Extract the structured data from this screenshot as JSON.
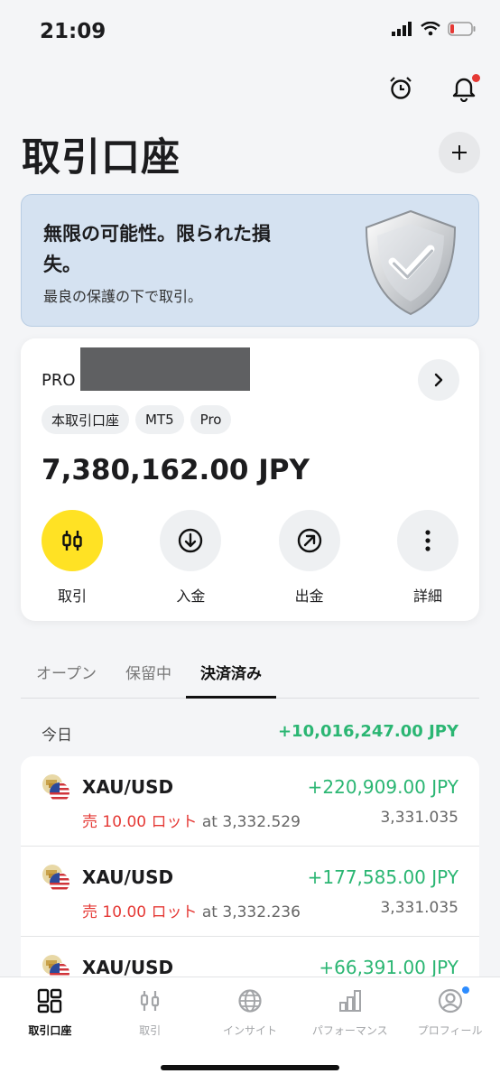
{
  "status_bar": {
    "time": "21:09"
  },
  "header": {
    "title": "取引口座"
  },
  "banner": {
    "title": "無限の可能性。限られた損失。",
    "subtitle": "最良の保護の下で取引。"
  },
  "account": {
    "name": "PRO",
    "tags": [
      "本取引口座",
      "MT5",
      "Pro"
    ],
    "balance": "7,380,162.00 JPY",
    "actions": [
      {
        "label": "取引",
        "icon": "trade-icon"
      },
      {
        "label": "入金",
        "icon": "deposit-icon"
      },
      {
        "label": "出金",
        "icon": "withdraw-icon"
      },
      {
        "label": "詳細",
        "icon": "more-icon"
      }
    ]
  },
  "tabs": [
    {
      "label": "オープン"
    },
    {
      "label": "保留中"
    },
    {
      "label": "決済済み"
    }
  ],
  "closed": {
    "day_label": "今日",
    "day_total": "+10,016,247.00 JPY",
    "positions": [
      {
        "symbol": "XAU/USD",
        "pnl": "+220,909.00 JPY",
        "side": "売 10.00 ロット",
        "open_price": "at 3,332.529",
        "close_price": "3,331.035"
      },
      {
        "symbol": "XAU/USD",
        "pnl": "+177,585.00 JPY",
        "side": "売 10.00 ロット",
        "open_price": "at 3,332.236",
        "close_price": "3,331.035"
      },
      {
        "symbol": "XAU/USD",
        "pnl": "+66,391.00 JPY",
        "side": "",
        "open_price": "",
        "close_price": ""
      }
    ]
  },
  "tabbar": [
    {
      "label": "取引口座",
      "icon": "accounts-icon"
    },
    {
      "label": "取引",
      "icon": "trade-icon"
    },
    {
      "label": "インサイト",
      "icon": "globe-icon"
    },
    {
      "label": "パフォーマンス",
      "icon": "chart-icon"
    },
    {
      "label": "プロフィール",
      "icon": "profile-icon"
    }
  ],
  "colors": {
    "accent": "#ffe224",
    "positive": "#2bb673",
    "negative": "#e53935",
    "banner": "#d5e2f1"
  }
}
